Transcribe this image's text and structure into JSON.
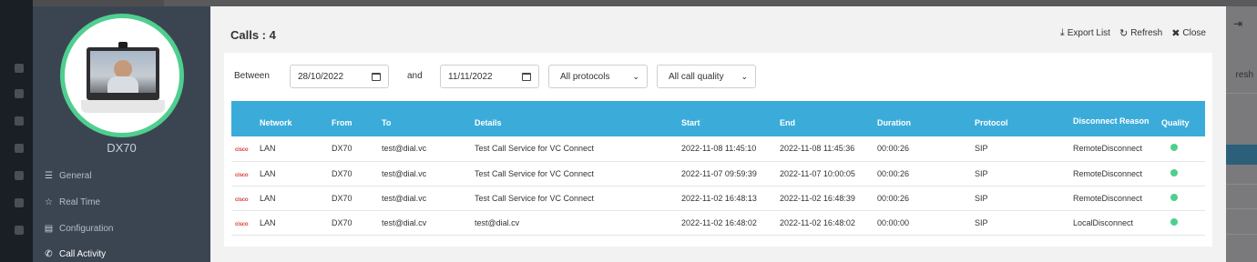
{
  "sidebar": {
    "device_name": "DX70",
    "menu": [
      {
        "label": "General",
        "icon": "list-icon"
      },
      {
        "label": "Real Time",
        "icon": "star-icon"
      },
      {
        "label": "Configuration",
        "icon": "server-icon"
      },
      {
        "label": "Call Activity",
        "icon": "phone-icon"
      }
    ]
  },
  "background": {
    "right_text": "resh"
  },
  "modal": {
    "title": "Calls : 4",
    "actions": {
      "export": "Export List",
      "refresh": "Refresh",
      "close": "Close"
    },
    "filters": {
      "between_label": "Between",
      "start_date": "28/10/2022",
      "and_label": "and",
      "end_date": "11/11/2022",
      "protocol": "All protocols",
      "quality": "All call quality"
    },
    "table": {
      "headers": [
        "Network",
        "From",
        "To",
        "Details",
        "Start",
        "End",
        "Duration",
        "Protocol",
        "Disconnect Reason",
        "Quality"
      ],
      "rows": [
        {
          "network": "LAN",
          "from": "DX70",
          "to": "test@dial.vc",
          "details": "Test Call Service for VC Connect",
          "start": "2022-11-08 11:45:10",
          "end": "2022-11-08 11:45:36",
          "duration": "00:00:26",
          "protocol": "SIP",
          "reason": "RemoteDisconnect",
          "quality": "good"
        },
        {
          "network": "LAN",
          "from": "DX70",
          "to": "test@dial.vc",
          "details": "Test Call Service for VC Connect",
          "start": "2022-11-07 09:59:39",
          "end": "2022-11-07 10:00:05",
          "duration": "00:00:26",
          "protocol": "SIP",
          "reason": "RemoteDisconnect",
          "quality": "good"
        },
        {
          "network": "LAN",
          "from": "DX70",
          "to": "test@dial.vc",
          "details": "Test Call Service for VC Connect",
          "start": "2022-11-02 16:48:13",
          "end": "2022-11-02 16:48:39",
          "duration": "00:00:26",
          "protocol": "SIP",
          "reason": "RemoteDisconnect",
          "quality": "good"
        },
        {
          "network": "LAN",
          "from": "DX70",
          "to": "test@dial.cv",
          "details": "test@dial.cv",
          "start": "2022-11-02 16:48:02",
          "end": "2022-11-02 16:48:02",
          "duration": "00:00:00",
          "protocol": "SIP",
          "reason": "LocalDisconnect",
          "quality": "good"
        }
      ],
      "vendor_logo_text": "cisco"
    }
  },
  "colors": {
    "header_blue": "#3bacd9",
    "quality_good": "#4fcf8f",
    "sidebar_bg": "#3b4552"
  }
}
